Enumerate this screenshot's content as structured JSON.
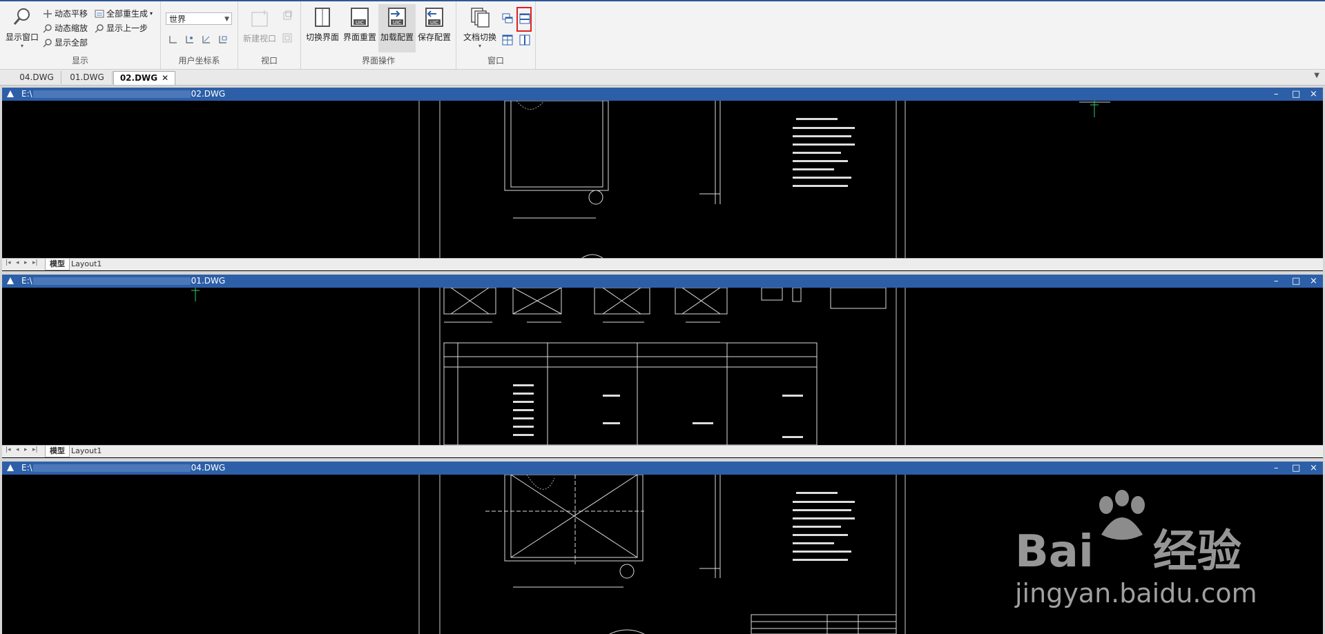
{
  "ribbon": {
    "display": {
      "show_window": "显示窗口",
      "pan": "动态平移",
      "zoom": "动态缩放",
      "show_all": "显示全部",
      "regen_all": "全部重生成",
      "prev_step": "显示上一步",
      "label": "显示"
    },
    "ucs": {
      "combo_value": "世界",
      "label": "用户坐标系"
    },
    "viewport": {
      "new_viewport": "新建视口",
      "label": "视口"
    },
    "ui_ops": {
      "switch_ui": "切换界面",
      "reset_ui": "界面重置",
      "load_config": "加载配置",
      "save_config": "保存配置",
      "label": "界面操作"
    },
    "window": {
      "doc_switch": "文档切换",
      "label": "窗口"
    }
  },
  "tabs": [
    {
      "label": "04.DWG"
    },
    {
      "label": "01.DWG"
    },
    {
      "label": "02.DWG",
      "active": true
    }
  ],
  "documents": [
    {
      "prefix": "E:\\",
      "suffix": "02.DWG"
    },
    {
      "prefix": "E:\\",
      "suffix": "01.DWG"
    },
    {
      "prefix": "E:\\",
      "suffix": "04.DWG"
    }
  ],
  "layout_tabs": {
    "model": "模型",
    "layout1": "Layout1"
  },
  "window_controls": {
    "minimize": "–",
    "maximize": "□",
    "close": "×"
  },
  "watermark": {
    "brand": "Bai",
    "brand2": "经验",
    "url": "jingyan.baidu.com"
  }
}
